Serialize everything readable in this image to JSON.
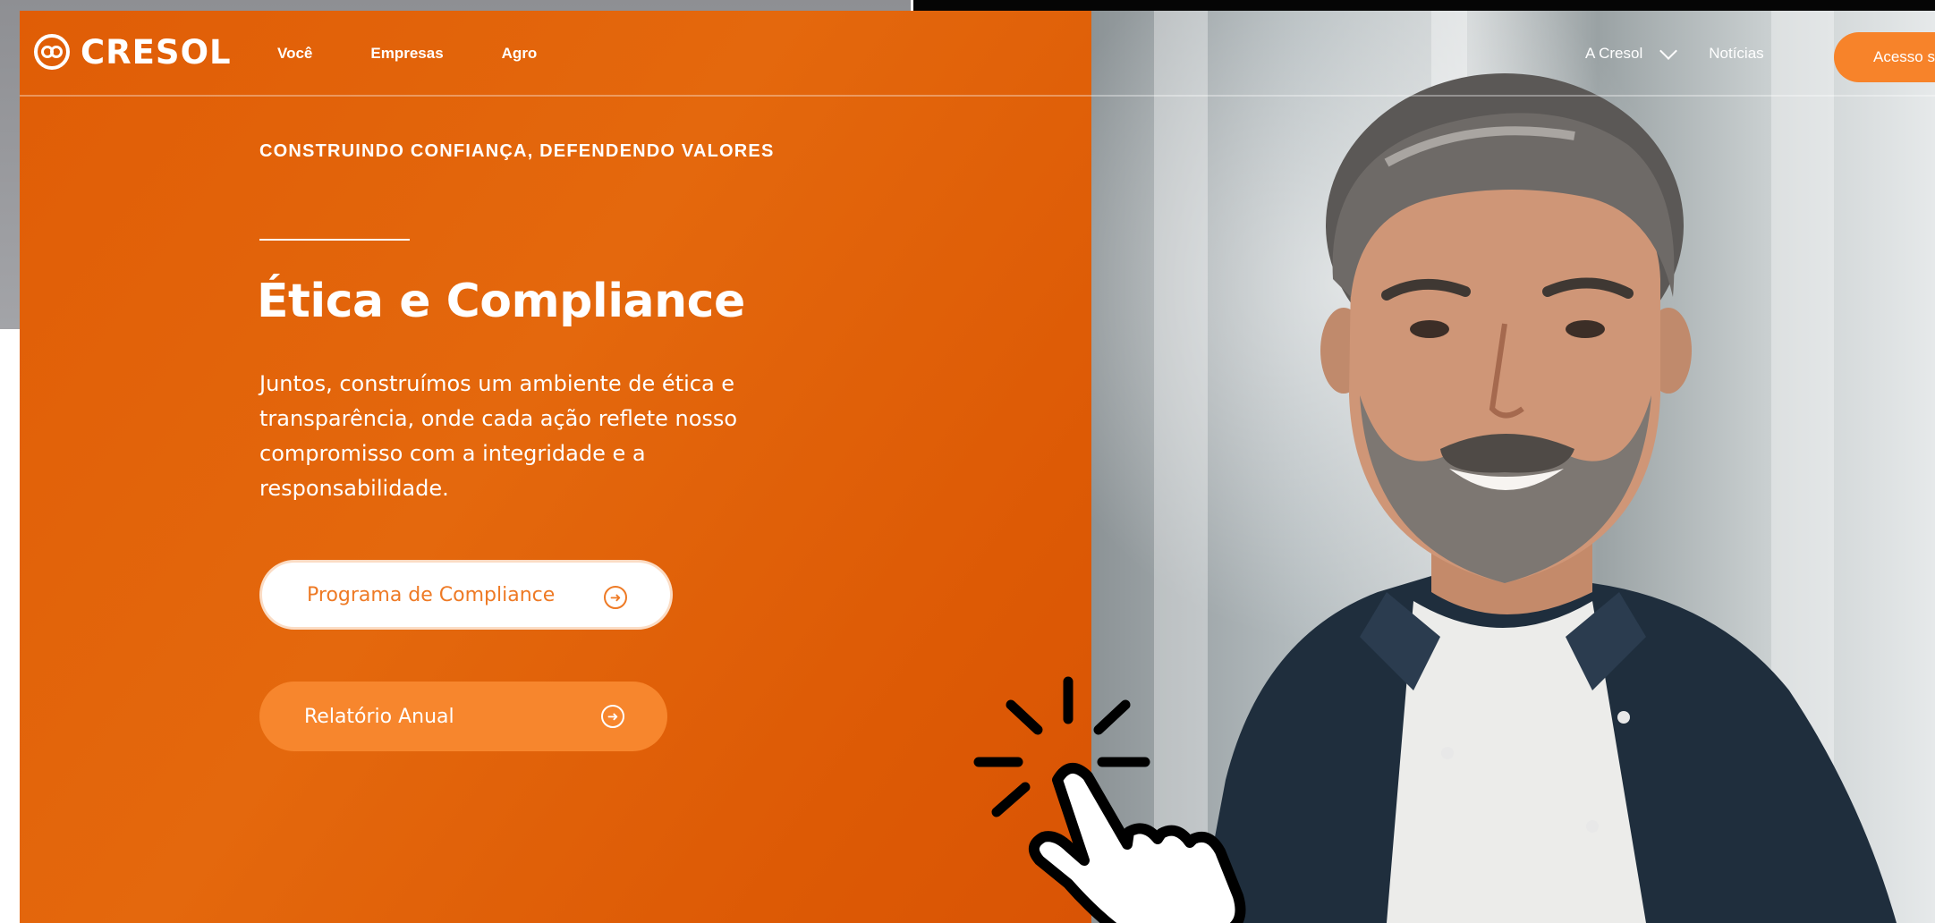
{
  "brand": {
    "name": "CRESOL"
  },
  "nav_left": [
    "Você",
    "Empresas",
    "Agro"
  ],
  "nav_right": {
    "dropdown_label": "A Cresol",
    "news_label": "Notícias",
    "access_button_label": "Acesso s"
  },
  "hero": {
    "eyebrow": "CONSTRUINDO CONFIANÇA, DEFENDENDO VALORES",
    "title": "Ética e Compliance",
    "description_lines": [
      "Juntos, construímos um ambiente de ética e",
      "transparência, onde cada ação reflete nosso",
      "compromisso com a integridade e a",
      "responsabilidade."
    ],
    "primary_button_label": "Programa de Compliance",
    "secondary_button_label": "Relatório Anual"
  },
  "colors": {
    "brand_orange": "#e0600a",
    "button_orange": "#f7862d",
    "button_text_orange": "#ee7a25",
    "white": "#ffffff"
  },
  "icons": {
    "logo": "cresol-logo-icon",
    "dropdown": "chevron-down-icon",
    "button_arrow": "arrow-right-circle-icon",
    "cursor": "hand-pointer-click-icon"
  }
}
